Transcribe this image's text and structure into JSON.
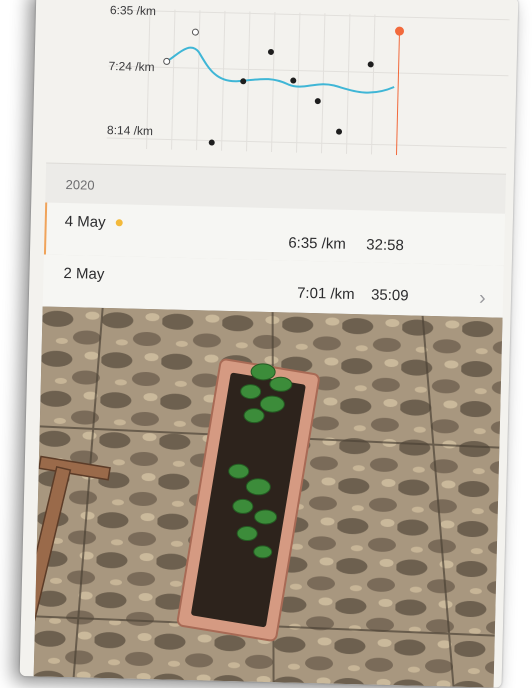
{
  "pace_chart": {
    "y_labels": [
      "6:35 /km",
      "7:24 /km",
      "8:14 /km"
    ],
    "colors": {
      "line": "#3fb6d6",
      "dot": "#1e1e1e",
      "current": "#f26a3c",
      "grid": "#e2e0dc"
    }
  },
  "year_header": "2020",
  "runs": [
    {
      "date": "4 May",
      "pace": "6:35 /km",
      "time": "32:58",
      "highlighted": true
    },
    {
      "date": "2 May",
      "pace": "7:01 /km",
      "time": "35:09",
      "highlighted": false
    }
  ],
  "icons": {
    "chevron": "chevron-right-icon",
    "marker": "current-run-marker-icon"
  }
}
